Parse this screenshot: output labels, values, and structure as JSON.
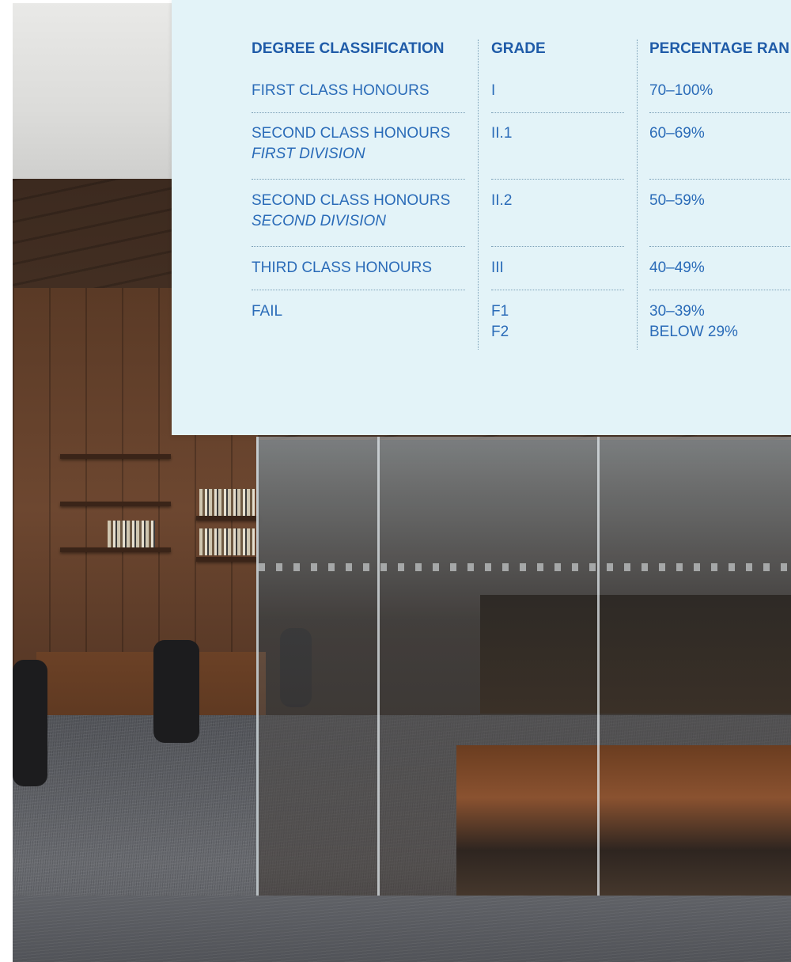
{
  "table": {
    "headers": [
      "DEGREE CLASSIFICATION",
      "GRADE",
      "PERCENTAGE RAN"
    ],
    "rows": [
      {
        "classification": "FIRST CLASS HONOURS",
        "division": "",
        "grade": "I",
        "grade_2": "",
        "range": "70–100%",
        "range_2": ""
      },
      {
        "classification": "SECOND CLASS HONOURS",
        "division": "FIRST DIVISION",
        "grade": "II.1",
        "grade_2": "",
        "range": "60–69%",
        "range_2": ""
      },
      {
        "classification": "SECOND CLASS HONOURS",
        "division": "SECOND DIVISION",
        "grade": "II.2",
        "grade_2": "",
        "range": "50–59%",
        "range_2": ""
      },
      {
        "classification": "THIRD CLASS HONOURS",
        "division": "",
        "grade": "III",
        "grade_2": "",
        "range": "40–49%",
        "range_2": ""
      },
      {
        "classification": "FAIL",
        "division": "",
        "grade": "F1",
        "grade_2": "F2",
        "range": "30–39%",
        "range_2": "BELOW 29%"
      }
    ]
  },
  "colors": {
    "panel_background": "#e3f3f8",
    "header_text": "#1f5ba8",
    "body_text": "#2a6bb8"
  }
}
